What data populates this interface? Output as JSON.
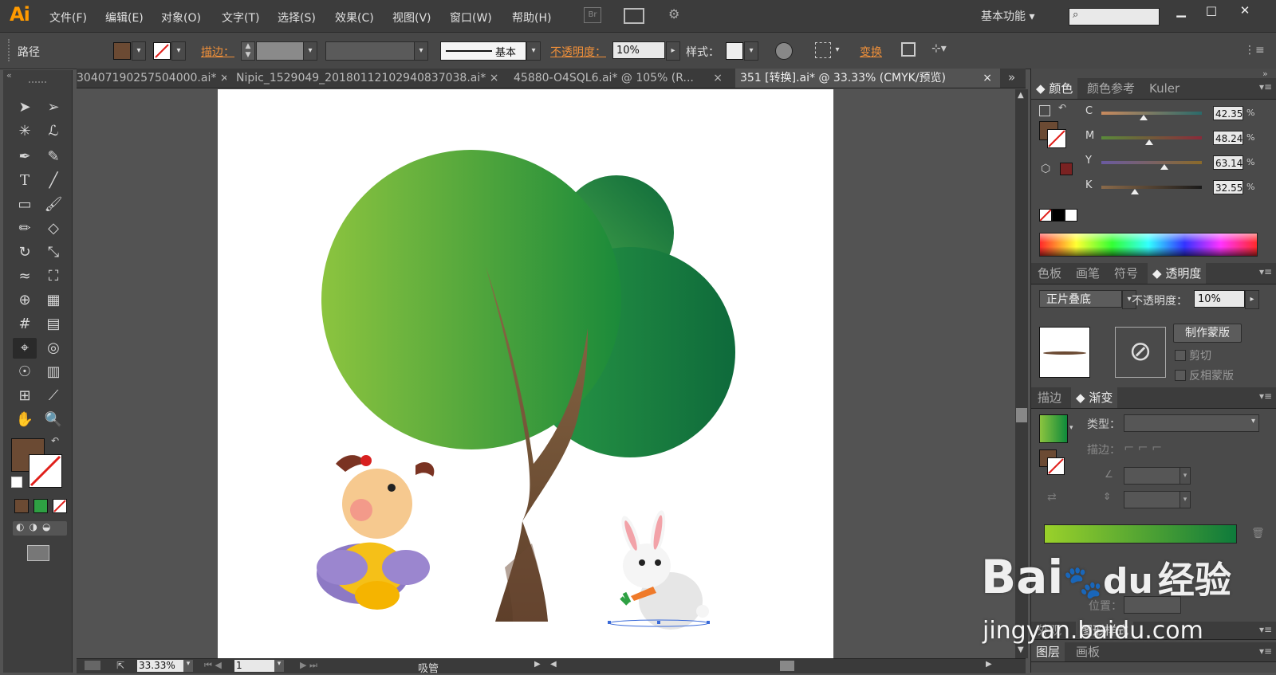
{
  "app": {
    "logo": "Ai"
  },
  "menu": [
    "文件(F)",
    "编辑(E)",
    "对象(O)",
    "文字(T)",
    "选择(S)",
    "效果(C)",
    "视图(V)",
    "窗口(W)",
    "帮助(H)"
  ],
  "menubar": {
    "bridge_label": "Br",
    "workspace": "基本功能",
    "minimize": "▁",
    "maximize": "□",
    "close": "✕"
  },
  "control": {
    "selection_type": "路径",
    "stroke_label": "描边：",
    "stroke_style": "基本",
    "opacity_label": "不透明度：",
    "opacity_value": "10%",
    "style_label": "样式：",
    "transform_label": "变换",
    "fill_color": "#6b4a33"
  },
  "tabs": [
    {
      "label": "30407190257504000.ai*",
      "close": "×"
    },
    {
      "label": "Nipic_1529049_20180112102940837038.ai*",
      "close": "×"
    },
    {
      "label": "45880-O4SQL6.ai* @ 105% (R...",
      "close": "×"
    },
    {
      "label": "351 [转换].ai* @ 33.33% (CMYK/预览)",
      "close": "×"
    }
  ],
  "status": {
    "zoom": "33.33%",
    "page": "1",
    "tool": "吸管"
  },
  "color_panel": {
    "tabs": [
      "颜色",
      "颜色参考",
      "Kuler"
    ],
    "channels": [
      {
        "name": "C",
        "value": "42.35",
        "fraction": 0.42
      },
      {
        "name": "M",
        "value": "48.24",
        "fraction": 0.48
      },
      {
        "name": "Y",
        "value": "63.14",
        "fraction": 0.63
      },
      {
        "name": "K",
        "value": "32.55",
        "fraction": 0.33
      }
    ],
    "percent_sign": "%"
  },
  "transparency_panel": {
    "tabs": [
      "色板",
      "画笔",
      "符号",
      "透明度"
    ],
    "blend_mode": "正片叠底",
    "opacity_label": "不透明度：",
    "opacity_value": "10%",
    "make_mask": "制作蒙版",
    "clip": "剪切",
    "invert_mask": "反相蒙版"
  },
  "gradient_panel": {
    "tabs": [
      "描边",
      "渐变"
    ],
    "type_label": "类型：",
    "stroke_label": "描边：",
    "position_label": "位置："
  },
  "bottom_tabs": [
    "外观",
    "图形样式"
  ],
  "layers_tabs": [
    "图层",
    "画板"
  ],
  "watermark": {
    "brand": "Bai",
    "brand2": "du",
    "cn": "经验",
    "url": "jingyan.baidu.com"
  },
  "colors": {
    "accent_orange": "#f0903a",
    "tree_green_light": "#8cc43f",
    "tree_green_dark": "#0e6a3b",
    "trunk_brown": "#6b4a33"
  }
}
